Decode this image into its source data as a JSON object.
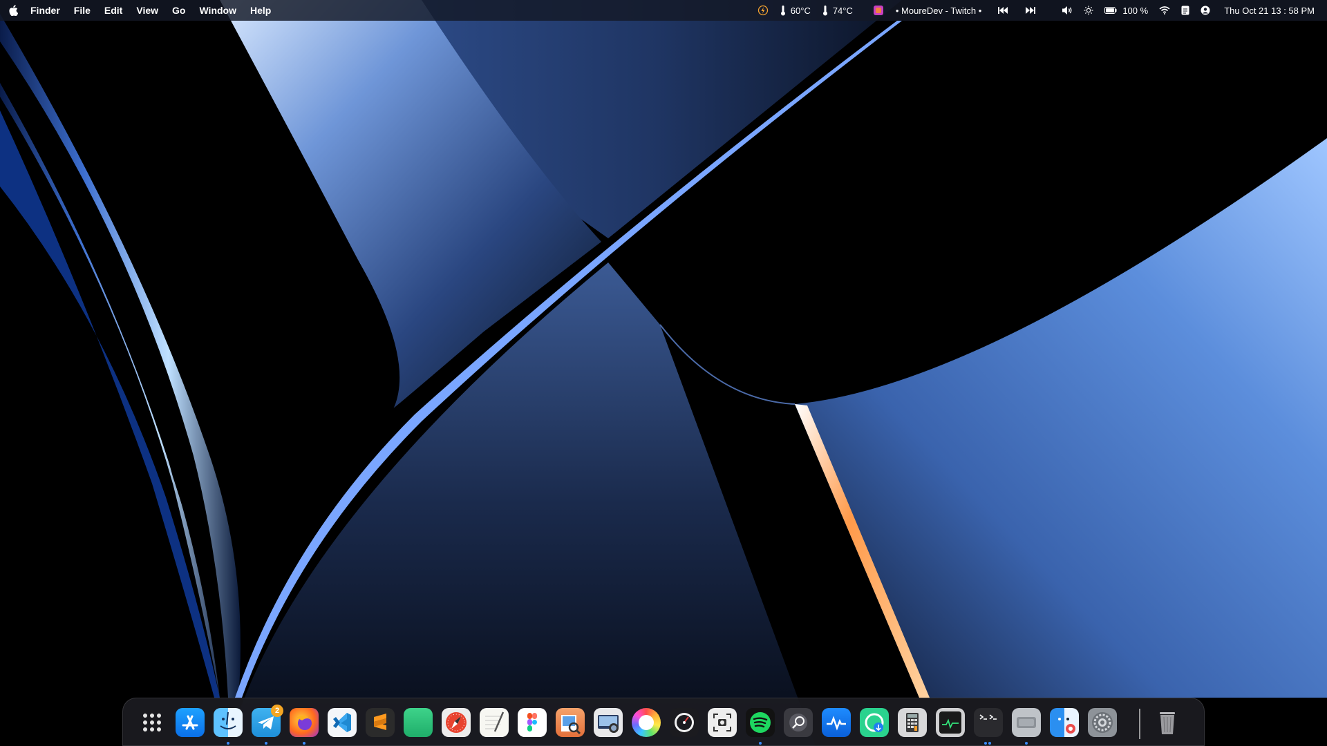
{
  "menubar": {
    "app_name": "Finder",
    "menus": [
      "File",
      "Edit",
      "View",
      "Go",
      "Window",
      "Help"
    ],
    "cpu_temp": "60°C",
    "gpu_temp": "74°C",
    "now_playing": "• MoureDev - Twitch •",
    "battery": "100 %",
    "datetime": "Thu Oct 21  13 : 58  PM",
    "icons": [
      "apple-logo",
      "power-icon",
      "thermometer-icon",
      "app-icon",
      "previous-track-icon",
      "next-track-icon",
      "volume-icon",
      "brightness-icon",
      "battery-icon",
      "wifi-icon",
      "notes-icon",
      "user-icon"
    ]
  },
  "dock": {
    "apps": [
      {
        "name": "launchpad",
        "running": false
      },
      {
        "name": "app-store",
        "running": false
      },
      {
        "name": "finder",
        "running": true
      },
      {
        "name": "telegram",
        "running": true,
        "badge": "2"
      },
      {
        "name": "firefox",
        "running": true
      },
      {
        "name": "vscode",
        "running": false
      },
      {
        "name": "sublime-text",
        "running": false
      },
      {
        "name": "green-app",
        "running": false
      },
      {
        "name": "safari-like",
        "running": false
      },
      {
        "name": "textedit",
        "running": false
      },
      {
        "name": "figma",
        "running": false
      },
      {
        "name": "preview",
        "running": false
      },
      {
        "name": "image-capture",
        "running": false
      },
      {
        "name": "color-wheel",
        "running": false
      },
      {
        "name": "disk-utility",
        "running": false
      },
      {
        "name": "screenshot",
        "running": false
      },
      {
        "name": "spotify",
        "running": true
      },
      {
        "name": "disk-inspector",
        "running": false
      },
      {
        "name": "activity-monitor-app",
        "running": false
      },
      {
        "name": "download-app",
        "running": false
      },
      {
        "name": "calculator",
        "running": false
      },
      {
        "name": "activity-monitor",
        "running": false
      },
      {
        "name": "terminal",
        "running": true,
        "dots": 2
      },
      {
        "name": "system-info",
        "running": true
      },
      {
        "name": "finder-settings",
        "running": false
      },
      {
        "name": "system-preferences",
        "running": false
      }
    ],
    "trash": "trash"
  },
  "colors": {
    "wallpaper_blue": "#4a7fd6",
    "wallpaper_light": "#cfe3ff",
    "wallpaper_orange": "#ff9a4a",
    "menubar_bg": "#141826",
    "dock_bg": "#1c1c22",
    "run_dot": "#3a8cff",
    "badge": "#f5a623"
  }
}
